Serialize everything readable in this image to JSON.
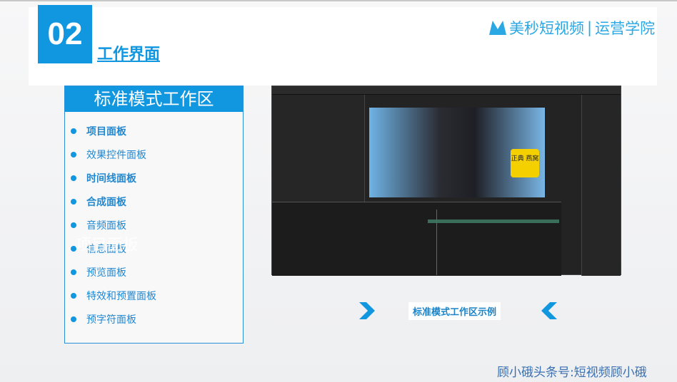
{
  "header": {
    "number": "02",
    "title": "工作界面",
    "logo_text": "美秒短视频",
    "logo_sub": "运营学院"
  },
  "panel": {
    "title": "标准模式工作区",
    "items": [
      {
        "label": "项目面板",
        "bold": true
      },
      {
        "label": "效果控件面板",
        "bold": false
      },
      {
        "label": "时间线面板",
        "bold": true
      },
      {
        "label": "合成面板",
        "bold": true
      },
      {
        "label": "音频面板",
        "bold": false
      },
      {
        "label": "信息面板",
        "bold": false
      },
      {
        "label": "预览面板",
        "bold": false
      },
      {
        "label": "特效和预置面板",
        "bold": false
      },
      {
        "label": "预字符面板",
        "bold": false
      }
    ],
    "ghost_text": "项目面板"
  },
  "screenshot": {
    "sign_text": "正典 燕窝"
  },
  "caption": "标准模式工作区示例",
  "watermark": "顾小硪头条号:短视频顾小硪"
}
